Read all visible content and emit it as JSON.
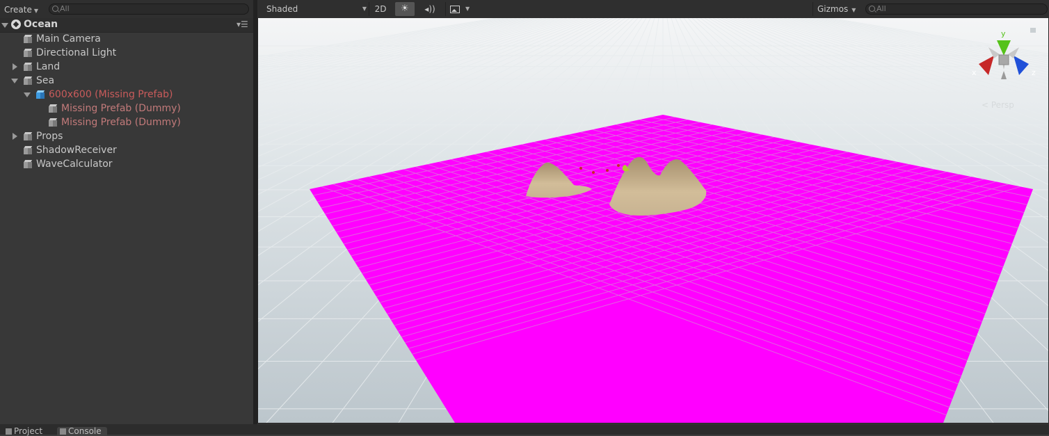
{
  "hierarchy": {
    "create_label": "Create",
    "search_placeholder": "All",
    "scene_name": "Ocean",
    "items": [
      {
        "label": "Main Camera",
        "depth": 0,
        "expander": "none",
        "state": "normal"
      },
      {
        "label": "Directional Light",
        "depth": 0,
        "expander": "none",
        "state": "normal"
      },
      {
        "label": "Land",
        "depth": 0,
        "expander": "collapsed",
        "state": "normal"
      },
      {
        "label": "Sea",
        "depth": 0,
        "expander": "expanded",
        "state": "normal"
      },
      {
        "label": "600x600 (Missing Prefab)",
        "depth": 1,
        "expander": "expanded",
        "state": "missing-prefab"
      },
      {
        "label": "Missing Prefab (Dummy)",
        "depth": 2,
        "expander": "none",
        "state": "missing"
      },
      {
        "label": "Missing Prefab (Dummy)",
        "depth": 2,
        "expander": "none",
        "state": "missing"
      },
      {
        "label": "Props",
        "depth": 0,
        "expander": "collapsed",
        "state": "normal"
      },
      {
        "label": "ShadowReceiver",
        "depth": 0,
        "expander": "none",
        "state": "normal"
      },
      {
        "label": "WaveCalculator",
        "depth": 0,
        "expander": "none",
        "state": "normal"
      }
    ]
  },
  "scene_toolbar": {
    "draw_mode": "Shaded",
    "mode_2d": "2D",
    "gizmos_label": "Gizmos",
    "search_placeholder": "All"
  },
  "gizmo": {
    "y_label": "y",
    "x_label": "x",
    "z_label": "z",
    "projection_label": "Persp"
  },
  "bottom_tabs": {
    "project": "Project",
    "console": "Console"
  },
  "colors": {
    "plane": "#ff00ff",
    "terrain": "#c8b392",
    "sky_top": "#f2f4f5",
    "ground": "#c3ccd1",
    "axis_y": "#55c21a",
    "axis_x": "#c62828",
    "axis_z": "#2050d8"
  }
}
